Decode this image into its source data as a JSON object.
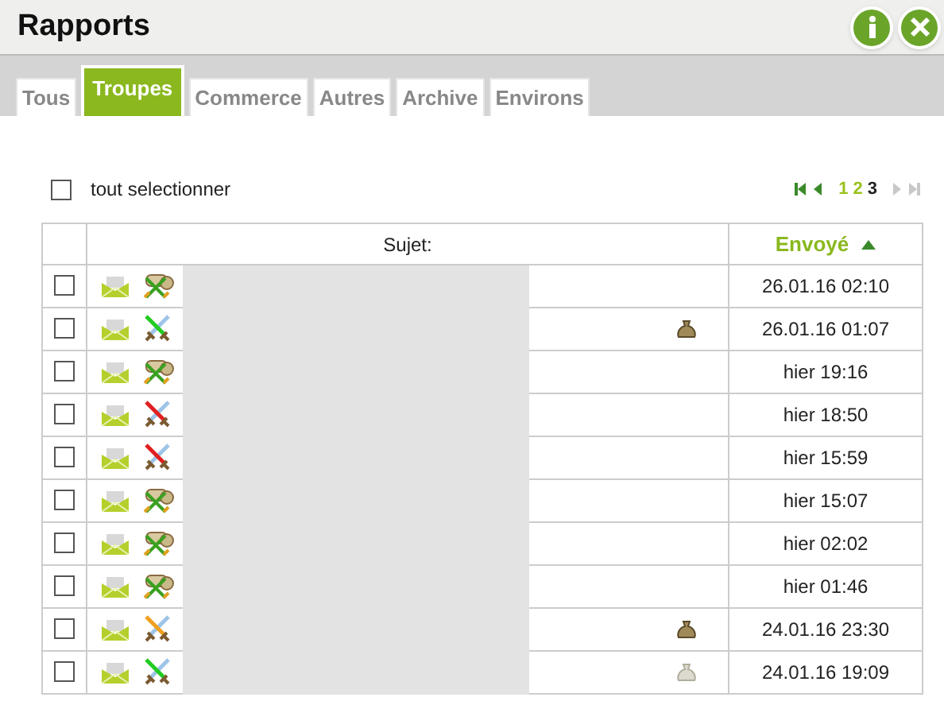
{
  "window": {
    "title": "Rapports"
  },
  "tabs": [
    {
      "label": "Tous",
      "selected": false
    },
    {
      "label": "Troupes",
      "selected": true
    },
    {
      "label": "Commerce",
      "selected": false
    },
    {
      "label": "Autres",
      "selected": false
    },
    {
      "label": "Archive",
      "selected": false
    },
    {
      "label": "Environs",
      "selected": false
    }
  ],
  "select_all": {
    "label": "tout selectionner",
    "checked": false
  },
  "pager": {
    "first_disabled": false,
    "prev_disabled": false,
    "next_disabled": true,
    "last_disabled": true,
    "pages": [
      {
        "label": "1",
        "selected": false
      },
      {
        "label": "2",
        "selected": false
      },
      {
        "label": "3",
        "selected": true
      }
    ]
  },
  "table": {
    "columns": [
      {
        "label": "Sujet:",
        "sorted": false
      },
      {
        "label": "Envoyé",
        "sorted": true
      }
    ],
    "rows": [
      {
        "checked": false,
        "kind": "scout",
        "sent": "26.01.16 02:10"
      },
      {
        "checked": false,
        "kind": "win",
        "sack": {
          "kind": "full"
        },
        "sent": "26.01.16 01:07"
      },
      {
        "checked": false,
        "kind": "scout",
        "sent": "hier 19:16"
      },
      {
        "checked": false,
        "kind": "loss",
        "sent": "hier 18:50"
      },
      {
        "checked": false,
        "kind": "loss",
        "sent": "hier 15:59"
      },
      {
        "checked": false,
        "kind": "scout",
        "sent": "hier 15:07"
      },
      {
        "checked": false,
        "kind": "scout",
        "sent": "hier 02:02"
      },
      {
        "checked": false,
        "kind": "scout",
        "sent": "hier 01:46"
      },
      {
        "checked": false,
        "kind": "partial",
        "sack": {
          "kind": "full"
        },
        "sent": "24.01.16 23:30"
      },
      {
        "checked": false,
        "kind": "win",
        "sack": {
          "kind": "empty"
        },
        "sent": "24.01.16 19:09"
      }
    ]
  }
}
